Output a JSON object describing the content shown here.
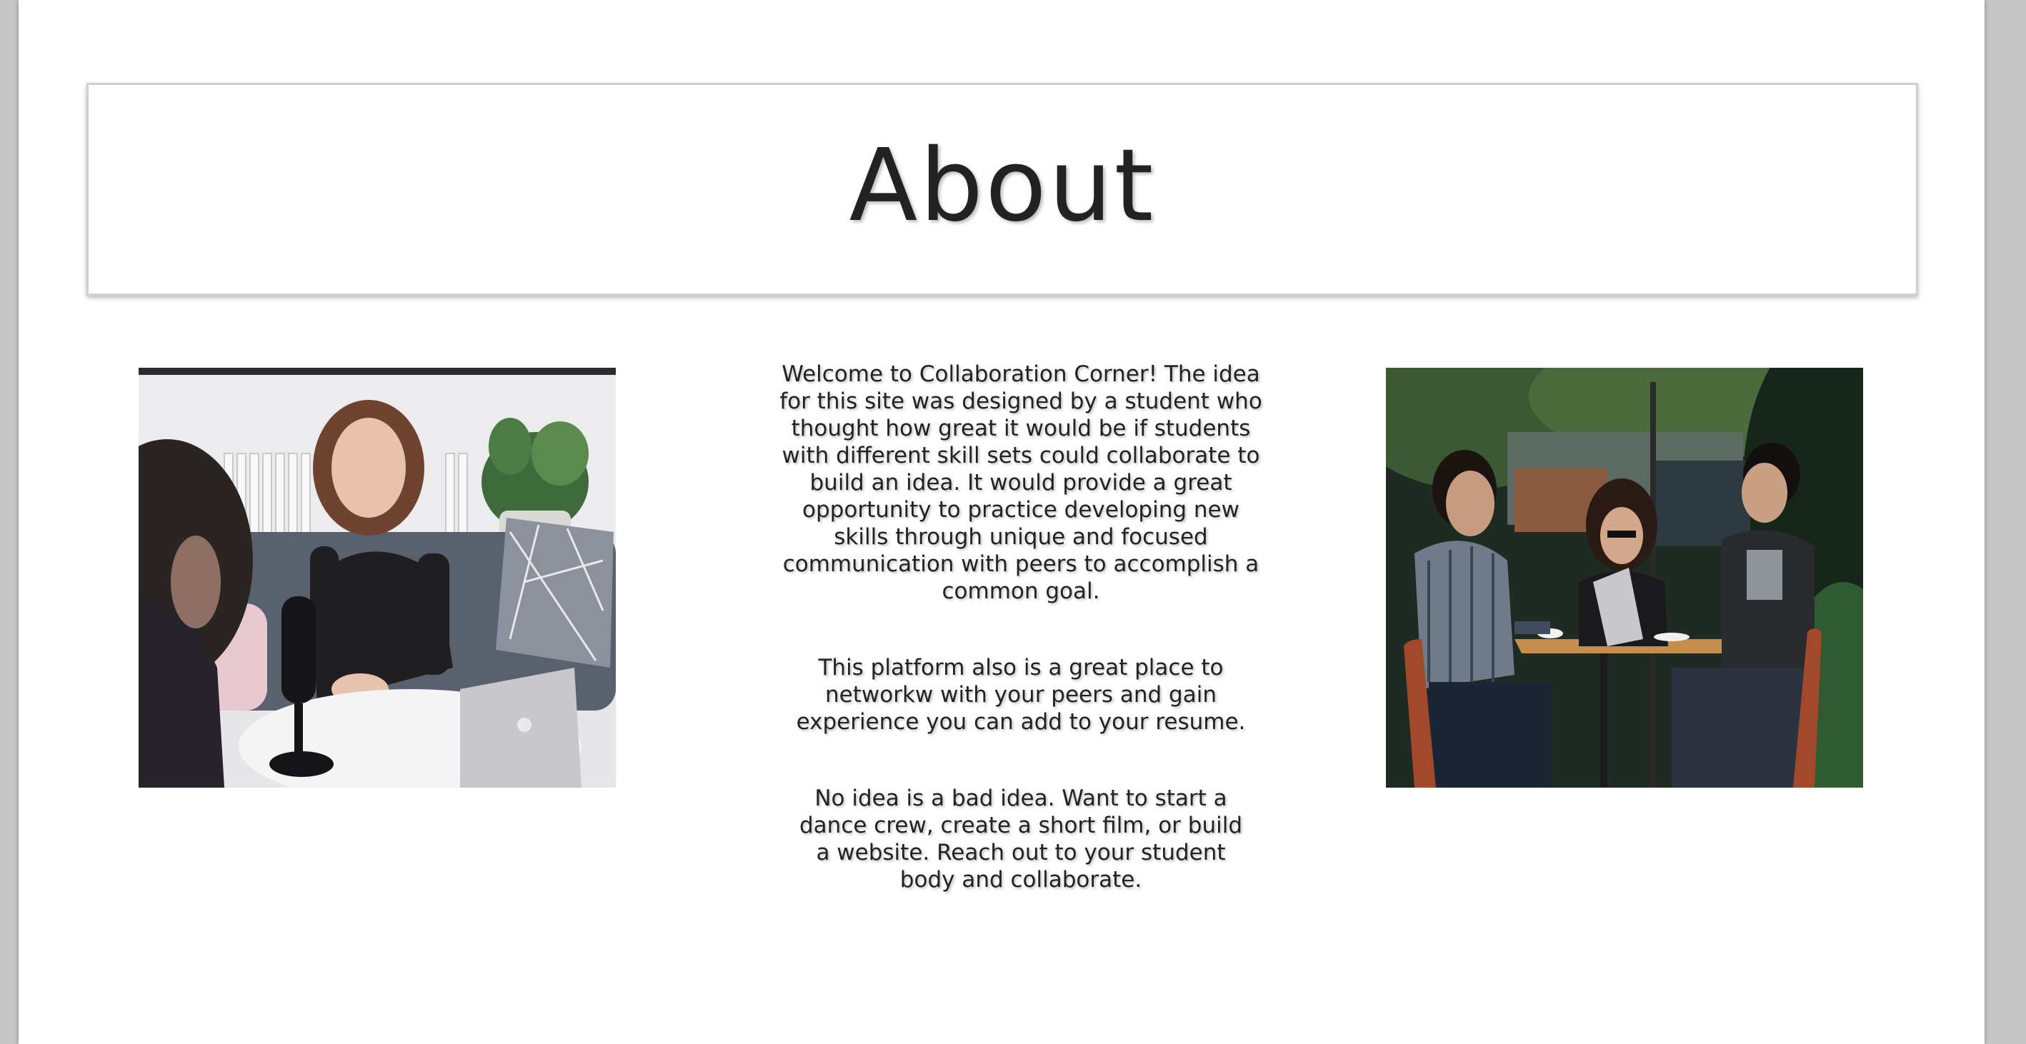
{
  "header": {
    "title": "About"
  },
  "main": {
    "paragraphs": [
      "Welcome to Collaboration Corner! The idea for this site was designed by a student who thought how great it would be if students with different skill sets could collaborate to build an idea. It would provide a great opportunity to practice developing new skills through unique and focused communication with peers to accomplish a common goal.",
      "This platform also is a great place to networkw with your peers and gain experience you can add to your resume.",
      "No idea is a bad idea. Want to start a dance crew, create a short film, or build a website. Reach out to your student body and collaborate."
    ],
    "images": {
      "left": "podcast-recording-photo",
      "right": "students-cafe-laptop-photo"
    }
  },
  "colors": {
    "text": "#222222",
    "page_background": "#ffffff",
    "outer_background": "#c6c6c6",
    "box_border": "#d0d0d0"
  }
}
